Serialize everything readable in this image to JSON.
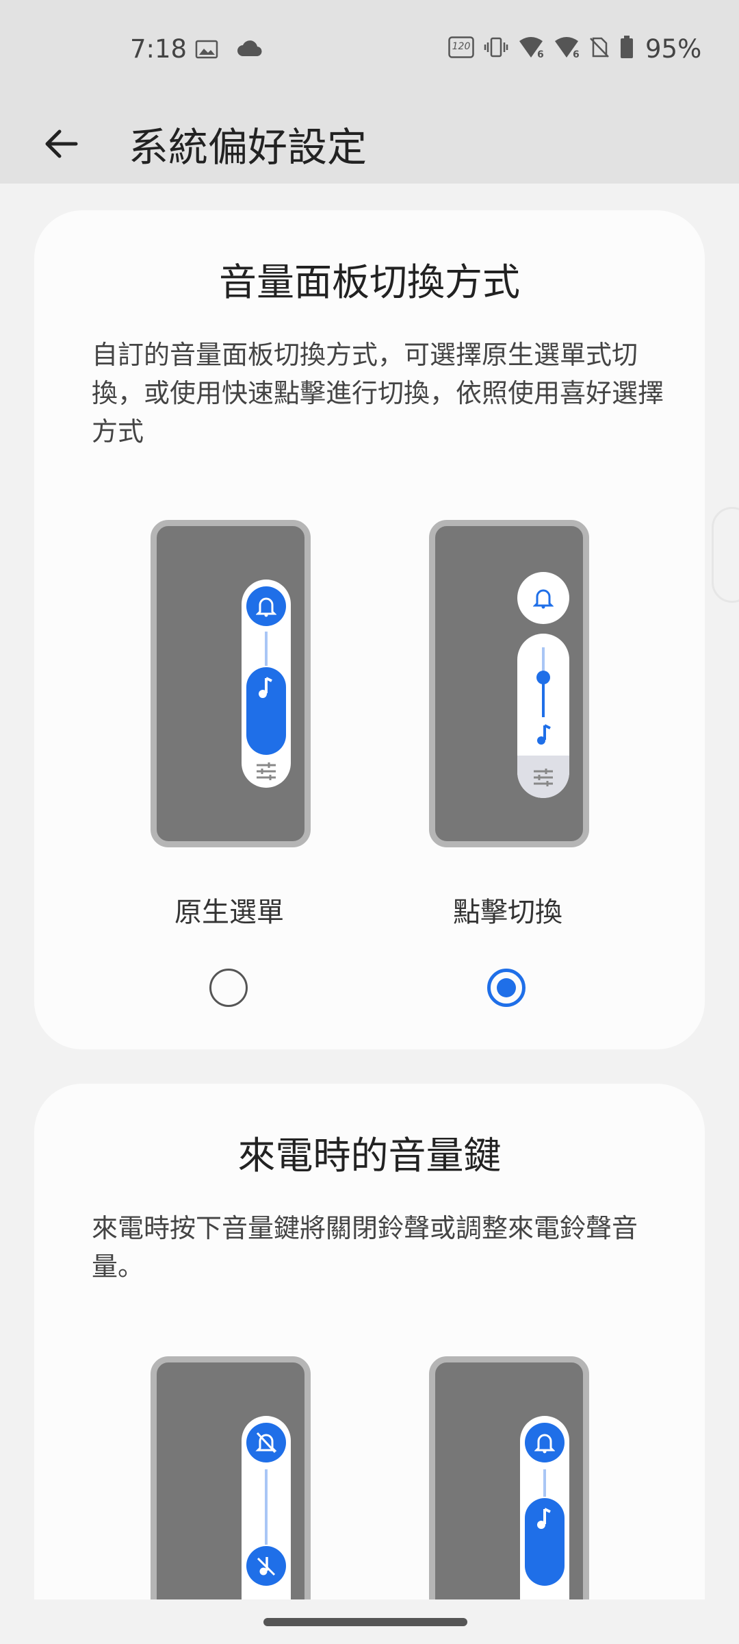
{
  "status_bar": {
    "time": "7:18",
    "battery": "95%",
    "icons": [
      "gallery-icon",
      "cloud-icon",
      "refresh-rate-120hz-icon",
      "vibrate-icon",
      "wifi-6-icon",
      "wifi-6-icon",
      "no-sim-icon",
      "battery-icon"
    ],
    "refresh_rate_label": "120",
    "wifi_label": "6"
  },
  "header": {
    "title": "系統偏好設定",
    "back_icon": "arrow-back-icon"
  },
  "cards": [
    {
      "title": "音量面板切換方式",
      "description": "自訂的音量面板切換方式，可選擇原生選單式切換，或使用快速點擊進行切換，依照使用喜好選擇方式",
      "options": [
        {
          "label": "原生選單",
          "selected": false
        },
        {
          "label": "點擊切換",
          "selected": true
        }
      ]
    },
    {
      "title": "來電時的音量鍵",
      "description": "來電時按下音量鍵將關閉鈴聲或調整來電鈴聲音量。"
    }
  ],
  "colors": {
    "accent": "#1f6fe8",
    "status_bar_bg": "#e2e2e2",
    "card_bg": "#fcfcfc",
    "page_bg": "#f2f2f2"
  }
}
